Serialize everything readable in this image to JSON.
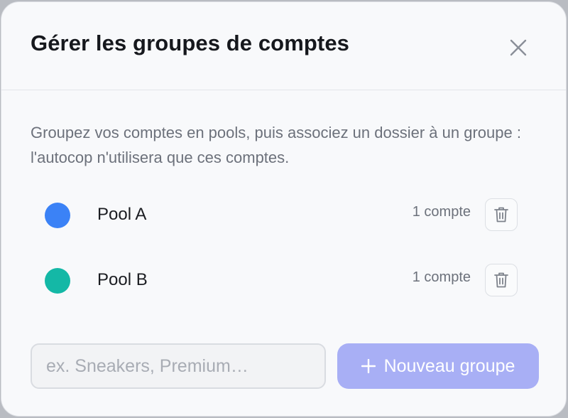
{
  "dialog": {
    "title": "Gérer les groupes de comptes",
    "close_icon": "close-icon",
    "description": "Groupez vos comptes en pools, puis associez un dossier à un groupe : l'autocop n'utilisera que ces comptes."
  },
  "groups": [
    {
      "name": "Pool A",
      "count": "1 compte",
      "color": "#3b82f6",
      "delete_icon": "trash-icon"
    },
    {
      "name": "Pool B",
      "count": "1 compte",
      "color": "#14b8a6",
      "delete_icon": "trash-icon"
    }
  ],
  "new_group": {
    "placeholder": "ex. Sneakers, Premium…",
    "value": "",
    "button_label": "Nouveau groupe",
    "button_icon": "plus-icon"
  },
  "colors": {
    "accent_button": "#a8aff5",
    "title_text": "#16181d",
    "muted_text": "#6c717b"
  }
}
